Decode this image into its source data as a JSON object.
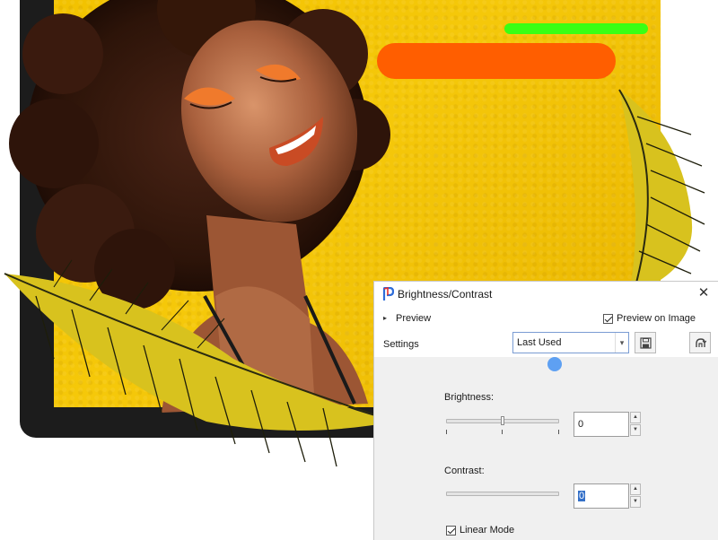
{
  "dialog": {
    "title": "Brightness/Contrast",
    "close_label": "✕",
    "preview_label": "Preview",
    "preview_on_image": {
      "label": "Preview on Image",
      "checked": true
    },
    "settings": {
      "label": "Settings",
      "selected": "Last Used"
    },
    "brightness": {
      "label": "Brightness:",
      "value": "0"
    },
    "contrast": {
      "label": "Contrast:",
      "value": "0"
    },
    "linear_mode": {
      "label": "Linear Mode",
      "checked": true
    }
  },
  "artwork": {
    "background_color": "#f2c200",
    "accent_green": "#39ff14",
    "accent_orange": "#ff5e00"
  },
  "icons": [
    "app-icon",
    "close-icon",
    "caret-icon",
    "dropdown-arrow-icon",
    "save-icon",
    "reset-icon",
    "spin-up-icon",
    "spin-down-icon"
  ]
}
